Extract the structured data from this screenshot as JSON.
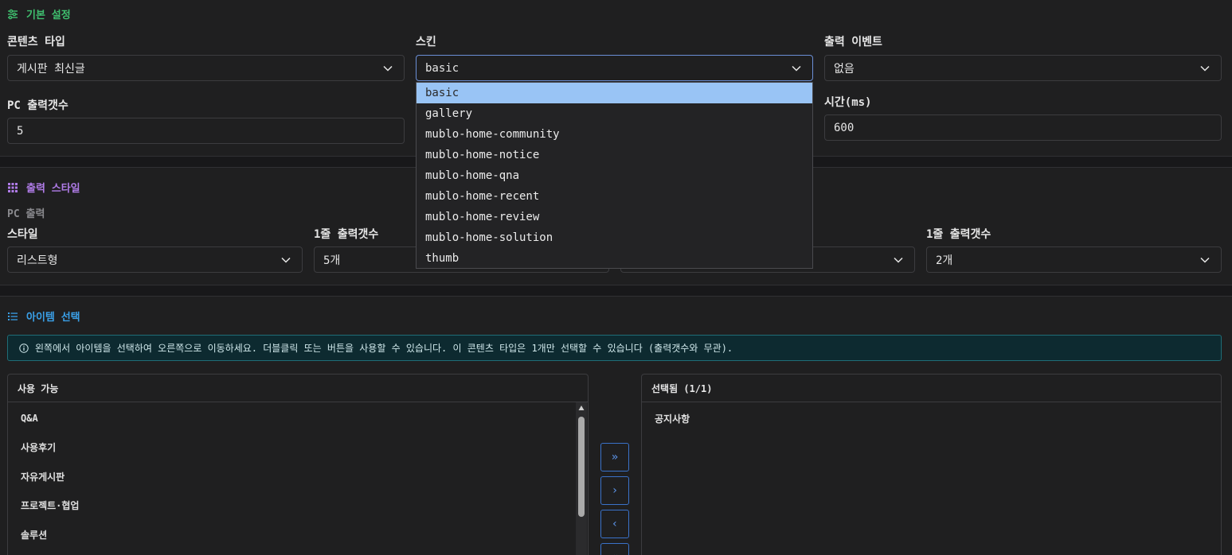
{
  "basic_section": {
    "title": "기본 설정",
    "content_type": {
      "label": "콘텐츠 타입",
      "value": "게시판 최신글"
    },
    "skin": {
      "label": "스킨",
      "value": "basic"
    },
    "output_event": {
      "label": "출력 이벤트",
      "value": "없음"
    },
    "pc_count": {
      "label": "PC 출력갯수",
      "value": "5"
    },
    "time": {
      "label": "시간(ms)",
      "value": "600"
    }
  },
  "skin_dropdown": {
    "options": [
      "basic",
      "gallery",
      "mublo-home-community",
      "mublo-home-notice",
      "mublo-home-qna",
      "mublo-home-recent",
      "mublo-home-review",
      "mublo-home-solution",
      "thumb"
    ],
    "selected": "basic"
  },
  "style_section": {
    "title": "출력 스타일",
    "pc_output_label": "PC 출력",
    "style": {
      "label": "스타일",
      "value": "리스트형"
    },
    "per_row": {
      "label": "1줄 출력갯수",
      "value": "5개"
    },
    "per_row_2": {
      "label": "1줄 출력갯수",
      "value": "2개"
    }
  },
  "item_section": {
    "title": "아이템 선택",
    "info": "왼쪽에서 아이템을 선택하여 오른쪽으로 이동하세요. 더블클릭 또는 버튼을 사용할 수 있습니다. 이 콘텐츠 타입은 1개만 선택할 수 있습니다 (출력갯수와 무관).",
    "available": {
      "title": "사용 가능",
      "items": [
        "Q&A",
        "사용후기",
        "자유게시판",
        "프로젝트·협업",
        "솔루션"
      ]
    },
    "selected": {
      "title": "선택됨 (1/1)",
      "items": [
        "공지사항"
      ]
    },
    "buttons": {
      "add_all": "»",
      "add": "›",
      "remove": "‹",
      "remove_all": "«"
    }
  },
  "colors": {
    "green": "#3fbf6e",
    "purple": "#b07ce8",
    "blue": "#3aa0e8",
    "info_bg": "#0d2a30"
  }
}
